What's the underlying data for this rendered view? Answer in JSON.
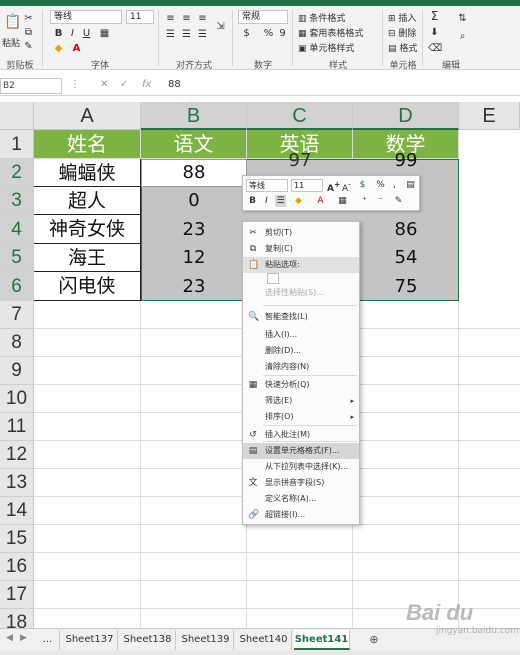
{
  "ribbon": {
    "font_name": "等线",
    "font_size": "11",
    "number_format": "常规",
    "clipboard_label": "粘贴",
    "groups": {
      "clipboard": "剪贴板",
      "font": "字体",
      "alignment": "对齐方式",
      "number": "数字",
      "styles": "样式",
      "cells": "单元格",
      "editing": "编辑"
    },
    "styles_items": [
      "条件格式",
      "套用表格格式",
      "单元格样式"
    ],
    "cells_items": [
      "插入",
      "删除",
      "格式"
    ],
    "font_buttons": [
      "B",
      "I",
      "U"
    ],
    "number_symbols": [
      "%",
      "9"
    ]
  },
  "formula_bar": {
    "name_box": "B2",
    "cancel": "✕",
    "confirm": "✓",
    "fx": "fx",
    "value": "88"
  },
  "grid": {
    "columns": [
      "A",
      "B",
      "C",
      "D",
      "E"
    ],
    "rows": [
      "1",
      "2",
      "3",
      "4",
      "5",
      "6",
      "7",
      "8",
      "9",
      "10",
      "11",
      "12",
      "13",
      "14",
      "15",
      "16",
      "17",
      "18"
    ],
    "headers": [
      "姓名",
      "语文",
      "英语",
      "数学"
    ],
    "names": [
      "蝙蝠侠",
      "超人",
      "神奇女侠",
      "海王",
      "闪电侠"
    ],
    "chinese": [
      "88",
      "0",
      "23",
      "12",
      "23"
    ],
    "english_visible": [
      "97"
    ],
    "math": [
      "99",
      "",
      "86",
      "54",
      "75"
    ]
  },
  "mini_toolbar": {
    "font_name": "等线",
    "font_size": "11",
    "bold": "B",
    "italic": "I",
    "percent": "%"
  },
  "context_menu": {
    "items": [
      {
        "icon": "✂",
        "label": "剪切(T)"
      },
      {
        "icon": "⧉",
        "label": "复制(C)"
      },
      {
        "icon": "📋",
        "label": "粘贴选项:"
      },
      {
        "icon": "",
        "label": "选择性粘贴(S)..."
      },
      {
        "icon": "🔍",
        "label": "智能查找(L)"
      },
      {
        "icon": "",
        "label": "插入(I)..."
      },
      {
        "icon": "",
        "label": "删除(D)..."
      },
      {
        "icon": "",
        "label": "清除内容(N)"
      },
      {
        "icon": "▦",
        "label": "快速分析(Q)"
      },
      {
        "icon": "",
        "label": "筛选(E)"
      },
      {
        "icon": "",
        "label": "排序(O)"
      },
      {
        "icon": "↺",
        "label": "插入批注(M)"
      },
      {
        "icon": "▤",
        "label": "设置单元格格式(F)..."
      },
      {
        "icon": "",
        "label": "从下拉列表中选择(K)..."
      },
      {
        "icon": "文",
        "label": "显示拼音字段(S)"
      },
      {
        "icon": "",
        "label": "定义名称(A)..."
      },
      {
        "icon": "🔗",
        "label": "超链接(I)..."
      }
    ],
    "submenu_arrow": "▸"
  },
  "sheet_tabs": {
    "ellipsis": "...",
    "tabs": [
      "Sheet137",
      "Sheet138",
      "Sheet139",
      "Sheet140",
      "Sheet141"
    ],
    "active_index": 4,
    "add": "⊕"
  },
  "watermark": {
    "brand": "Bai du",
    "sub": "jingyan.baidu.com"
  },
  "colors": {
    "excel_green": "#217346",
    "header_green": "#7cb342",
    "selection_gray": "#c4c4c4"
  }
}
